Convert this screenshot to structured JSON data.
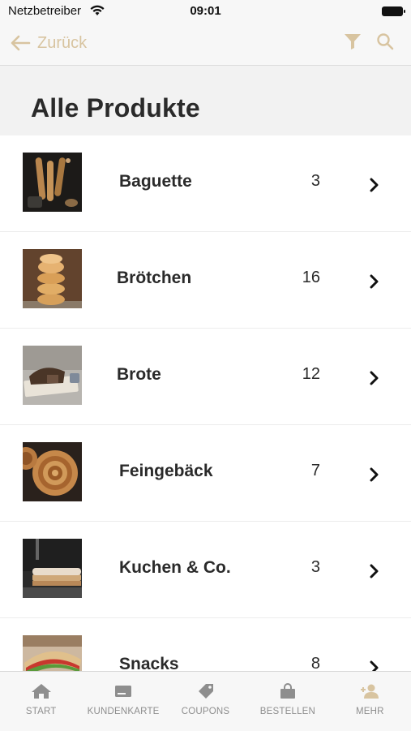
{
  "status": {
    "carrier": "Netzbetreiber",
    "time": "09:01"
  },
  "nav": {
    "back_label": "Zurück"
  },
  "page": {
    "title": "Alle Produkte"
  },
  "colors": {
    "accent": "#d8c4a0",
    "text": "#2a2a2a",
    "tab_inactive": "#8e8e8e"
  },
  "products": [
    {
      "name": "Baguette",
      "count": "3",
      "image": "baguette-photo"
    },
    {
      "name": "Brötchen",
      "count": "16",
      "image": "roll-stack-photo"
    },
    {
      "name": "Brote",
      "count": "12",
      "image": "bread-loaf-photo"
    },
    {
      "name": "Feingebäck",
      "count": "7",
      "image": "cinnamon-roll-photo"
    },
    {
      "name": "Kuchen & Co.",
      "count": "3",
      "image": "cake-photo"
    },
    {
      "name": "Snacks",
      "count": "8",
      "image": "sandwich-photo"
    }
  ],
  "tabs": [
    {
      "label": "START",
      "icon": "home-icon"
    },
    {
      "label": "KUNDENKARTE",
      "icon": "card-icon"
    },
    {
      "label": "COUPONS",
      "icon": "tag-icon"
    },
    {
      "label": "BESTELLEN",
      "icon": "bag-icon"
    },
    {
      "label": "MEHR",
      "icon": "add-person-icon",
      "active": true
    }
  ]
}
